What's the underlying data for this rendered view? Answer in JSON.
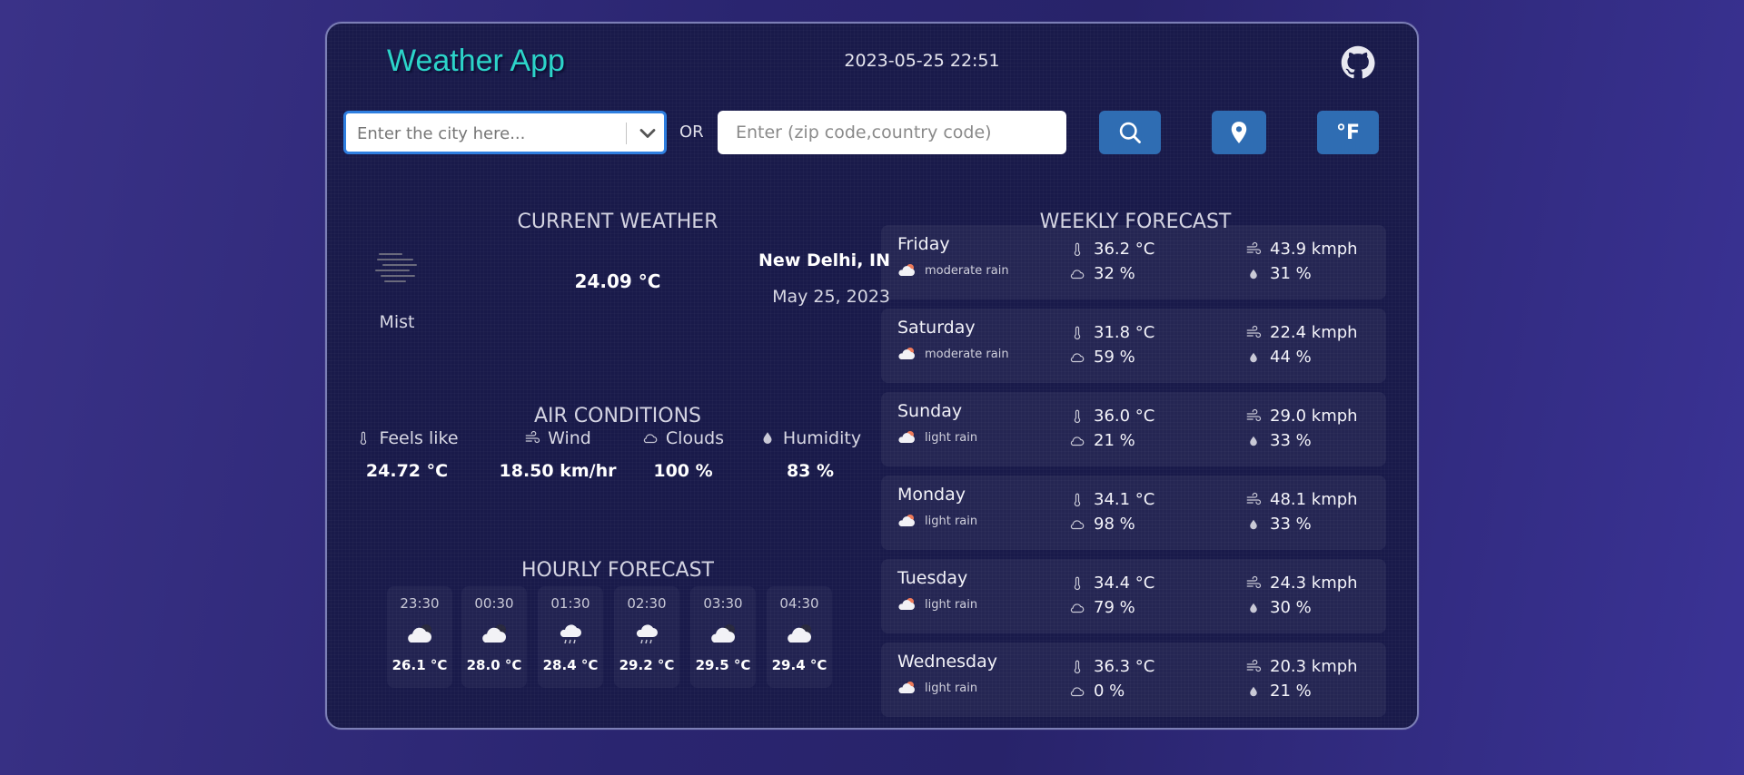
{
  "header": {
    "title": "Weather App",
    "datetime": "2023-05-25 22:51"
  },
  "search": {
    "city_placeholder": "Enter the city here...",
    "or_label": "OR",
    "zip_placeholder": "Enter (zip code,country code)",
    "unit_label": "°F"
  },
  "current": {
    "title": "CURRENT WEATHER",
    "description": "Mist",
    "temperature": "24.09 °C",
    "city": "New Delhi, IN",
    "date": "May 25, 2023"
  },
  "air": {
    "title": "AIR CONDITIONS",
    "feels_like": {
      "label": "Feels like",
      "value": "24.72 °C"
    },
    "wind": {
      "label": "Wind",
      "value": "18.50 km/hr"
    },
    "clouds": {
      "label": "Clouds",
      "value": "100 %"
    },
    "humidity": {
      "label": "Humidity",
      "value": "83 %"
    }
  },
  "hourly": {
    "title": "HOURLY FORECAST",
    "items": [
      {
        "time": "23:30",
        "temp": "26.1 °C"
      },
      {
        "time": "00:30",
        "temp": "28.0 °C"
      },
      {
        "time": "01:30",
        "temp": "28.4 °C"
      },
      {
        "time": "02:30",
        "temp": "29.2 °C"
      },
      {
        "time": "03:30",
        "temp": "29.5 °C"
      },
      {
        "time": "04:30",
        "temp": "29.4 °C"
      }
    ]
  },
  "weekly": {
    "title": "WEEKLY FORECAST",
    "days": [
      {
        "day": "Friday",
        "desc": "moderate rain",
        "temp": "36.2 °C",
        "clouds": "32 %",
        "wind": "43.9 kmph",
        "humidity": "31 %"
      },
      {
        "day": "Saturday",
        "desc": "moderate rain",
        "temp": "31.8 °C",
        "clouds": "59 %",
        "wind": "22.4 kmph",
        "humidity": "44 %"
      },
      {
        "day": "Sunday",
        "desc": "light rain",
        "temp": "36.0 °C",
        "clouds": "21 %",
        "wind": "29.0 kmph",
        "humidity": "33 %"
      },
      {
        "day": "Monday",
        "desc": "light rain",
        "temp": "34.1 °C",
        "clouds": "98 %",
        "wind": "48.1 kmph",
        "humidity": "33 %"
      },
      {
        "day": "Tuesday",
        "desc": "light rain",
        "temp": "34.4 °C",
        "clouds": "79 %",
        "wind": "24.3 kmph",
        "humidity": "30 %"
      },
      {
        "day": "Wednesday",
        "desc": "light rain",
        "temp": "36.3 °C",
        "clouds": "0 %",
        "wind": "20.3 kmph",
        "humidity": "21 %"
      }
    ]
  },
  "colors": {
    "accent_title": "#2cd4c9",
    "button": "#2f6db3",
    "focus_border": "#2f7fe0",
    "panel": "#191a4a"
  },
  "icons": {
    "github": "github-icon",
    "chevron": "chevron-down-icon",
    "search": "search-icon",
    "location": "location-pin-icon",
    "mist": "mist-icon",
    "thermometer": "thermometer-icon",
    "wind": "wind-icon",
    "cloud": "cloud-icon",
    "humidity": "droplet-icon",
    "rain": "rain-cloud-icon"
  }
}
